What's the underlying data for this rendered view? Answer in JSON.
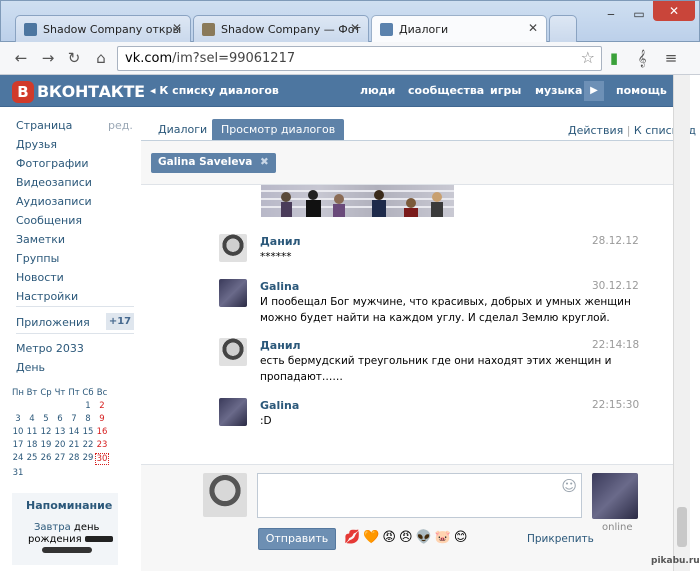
{
  "browser": {
    "tabs": [
      {
        "title": "Shadow Company откры"
      },
      {
        "title": "Shadow Company — Фот"
      },
      {
        "title": "Диалоги"
      }
    ],
    "url_host": "vk.com",
    "url_path": "/im?sel=99061217"
  },
  "header": {
    "logo": "ВКОНТАКТЕ",
    "back_link": "К списку диалогов",
    "nav": [
      "люди",
      "сообщества",
      "игры",
      "музыка",
      "помощь"
    ]
  },
  "sidebar": {
    "items": [
      "Страница",
      "Друзья",
      "Фотографии",
      "Видеозаписи",
      "Аудиозаписи",
      "Сообщения",
      "Заметки",
      "Группы",
      "Новости",
      "Настройки"
    ],
    "edit": "ред.",
    "apps": "Приложения",
    "apps_count": "+17",
    "extra": [
      "Метро 2033",
      "День"
    ],
    "calendar": {
      "days": [
        "Пн",
        "Вт",
        "Ср",
        "Чт",
        "Пт",
        "Сб",
        "Вс"
      ],
      "rows": [
        [
          "",
          "",
          "",
          "",
          "",
          "1",
          "2"
        ],
        [
          "3",
          "4",
          "5",
          "6",
          "7",
          "8",
          "9"
        ],
        [
          "10",
          "11",
          "12",
          "13",
          "14",
          "15",
          "16"
        ],
        [
          "17",
          "18",
          "19",
          "20",
          "21",
          "22",
          "23"
        ],
        [
          "24",
          "25",
          "26",
          "27",
          "28",
          "29",
          "30"
        ],
        [
          "31",
          "",
          "",
          "",
          "",
          "",
          ""
        ]
      ]
    },
    "reminder_title": "Напоминание",
    "reminder_link": "Завтра",
    "reminder_text1": " день",
    "reminder_text2": "рождения"
  },
  "dialogs": {
    "tab_dialogs": "Диалоги",
    "tab_view": "Просмотр диалогов",
    "actions": "Действия",
    "to_list": "К списку д",
    "chip": "Galina Saveleva"
  },
  "messages": [
    {
      "name": "Данил",
      "date": "28.12.12",
      "lines": [
        "******"
      ]
    },
    {
      "name": "Galina",
      "date": "30.12.12",
      "lines": [
        "И пообещал Бог мужчине, что красивых, добрых и умных женщин",
        "можно будет найти на каждом углу. И сделал Землю круглой."
      ]
    },
    {
      "name": "Данил",
      "date": "22:14:18",
      "lines": [
        "есть бермудский треугольник где они находят этих женщин и",
        "пропадают……"
      ]
    },
    {
      "name": "Galina",
      "date": "22:15:30",
      "lines": [
        ":D"
      ]
    }
  ],
  "compose": {
    "send": "Отправить",
    "attach": "Прикрепить",
    "status": "online",
    "emoji": [
      "💋",
      "🧡",
      "😡",
      "😠",
      "👽",
      "🐷",
      "😊"
    ]
  },
  "watermark": "pikabu.ru"
}
